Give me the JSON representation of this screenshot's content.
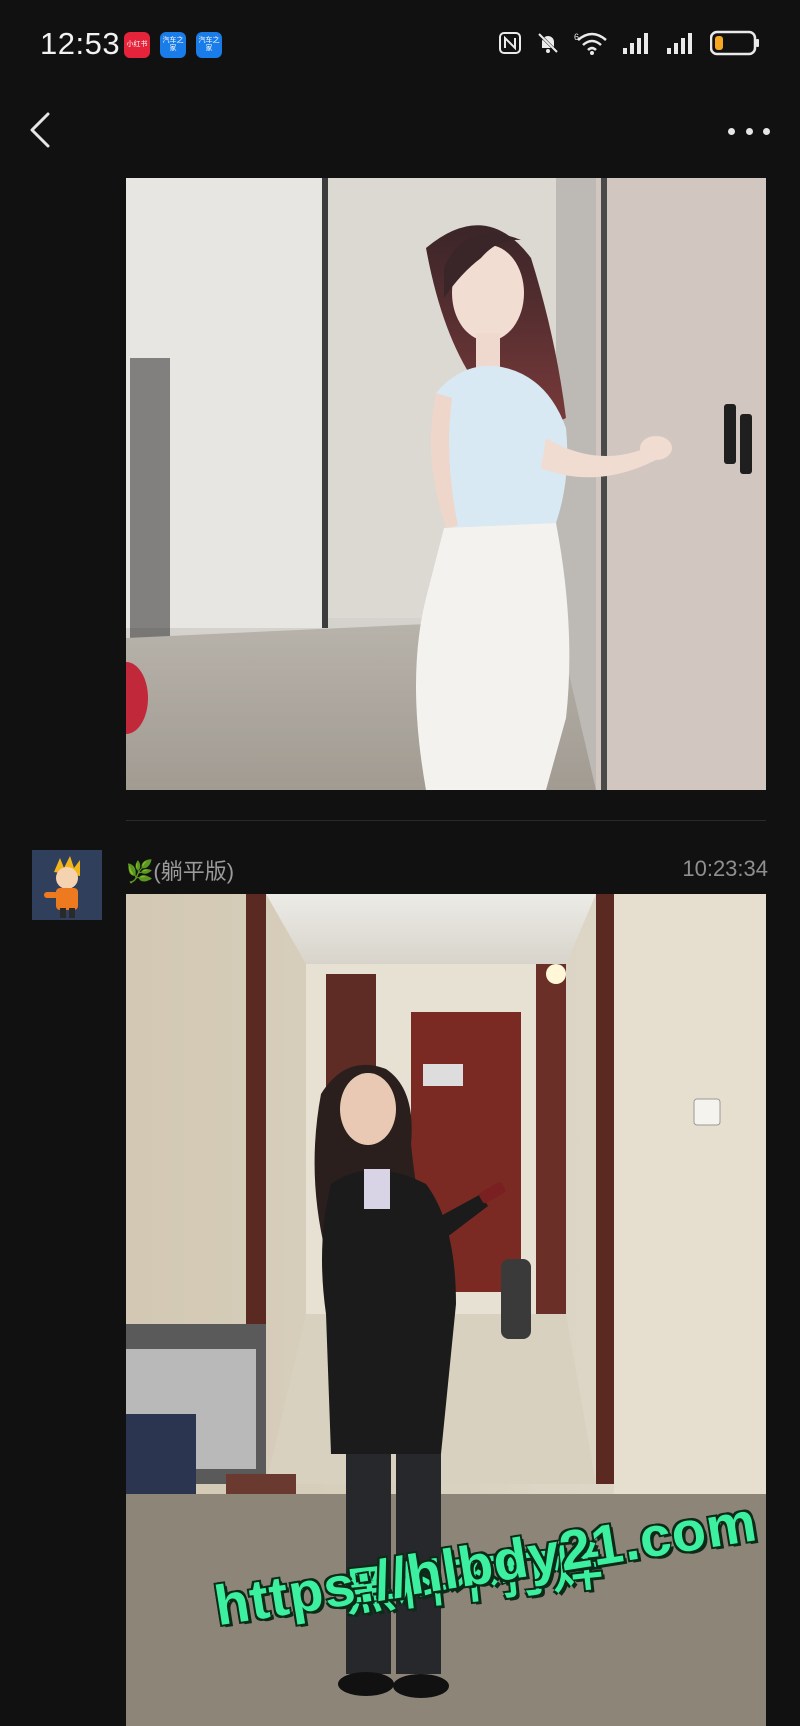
{
  "status_bar": {
    "time": "12:53",
    "apps": [
      {
        "icon": "xiaohongshu-app-icon",
        "label": "小红书",
        "color": "#e5243b"
      },
      {
        "icon": "car-app-icon",
        "label": "汽车之家",
        "color": "#1a7ce8"
      },
      {
        "icon": "car-app-icon",
        "label": "汽车之家",
        "color": "#1a7ce8"
      }
    ],
    "icons": [
      "nfc-icon",
      "mute-bell-icon",
      "wifi-6-icon",
      "signal-icon",
      "signal-icon",
      "battery-low-icon"
    ],
    "accent_battery": "#f5a623"
  },
  "nav": {
    "back_icon": "chevron-left-icon",
    "more_icon": "more-horizontal-icon"
  },
  "messages": [
    {
      "type": "image",
      "image_desc_icon": "photo-image"
    },
    {
      "sender": "🌿(躺平版)",
      "time": "10:23:34",
      "type": "image"
    }
  ],
  "watermark": {
    "line1": "黑料不打烊",
    "line2": "https://hlbdy21.com",
    "color": "#3cf0a0"
  }
}
